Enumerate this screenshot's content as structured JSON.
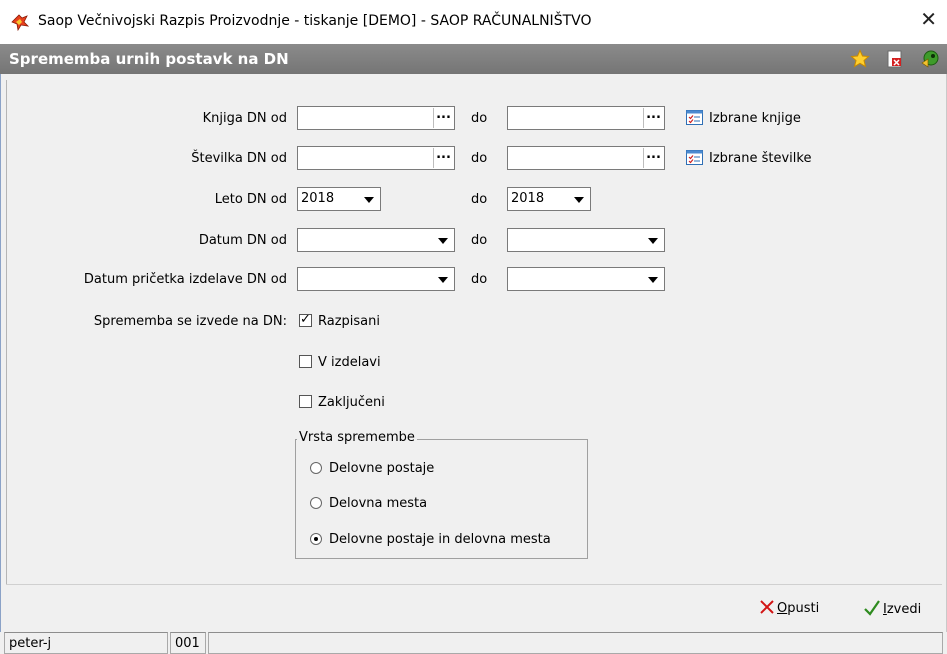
{
  "window": {
    "title": "Saop   Večnivojski Razpis Proizvodnje - tiskanje [DEMO] - SAOP RAČUNALNIŠTVO",
    "close": "✕"
  },
  "header": {
    "title": "Sprememba urnih postavk na DN",
    "icons": [
      "star-icon",
      "pdf-icon",
      "exit-icon"
    ]
  },
  "form": {
    "knjiga": {
      "label": "Knjiga DN od",
      "from": "",
      "to": "",
      "ellipsis": "...",
      "list_label": "Izbrane knjige"
    },
    "stevilka": {
      "label": "Številka DN od",
      "from": "",
      "to": "",
      "ellipsis": "...",
      "list_label": "Izbrane številke"
    },
    "leto": {
      "label": "Leto DN od",
      "from": "2018",
      "to": "2018"
    },
    "datum": {
      "label": "Datum DN od",
      "from": "",
      "to": ""
    },
    "datum_pricetka": {
      "label": "Datum pričetka izdelave DN od",
      "from": "",
      "to": ""
    },
    "do_label": "do",
    "status": {
      "label": "Sprememba se izvede na DN:",
      "options": [
        {
          "label": "Razpisani",
          "checked": true
        },
        {
          "label": "V izdelavi",
          "checked": false
        },
        {
          "label": "Zaključeni",
          "checked": false
        }
      ]
    },
    "vrsta": {
      "legend": "Vrsta spremembe",
      "options": [
        {
          "label": "Delovne postaje",
          "selected": false
        },
        {
          "label": "Delovna mesta",
          "selected": false
        },
        {
          "label": "Delovne postaje in delovna mesta",
          "selected": true
        }
      ]
    }
  },
  "actions": {
    "cancel": {
      "underline": "O",
      "rest": "pusti"
    },
    "execute": {
      "underline": "I",
      "rest": "zvedi"
    }
  },
  "status_bar": {
    "user": "peter-j",
    "code": "001",
    "extra": ""
  },
  "colors": {
    "header_bg": "#808080",
    "cancel_x": "#d21414",
    "ok_check": "#2e8b1f"
  }
}
